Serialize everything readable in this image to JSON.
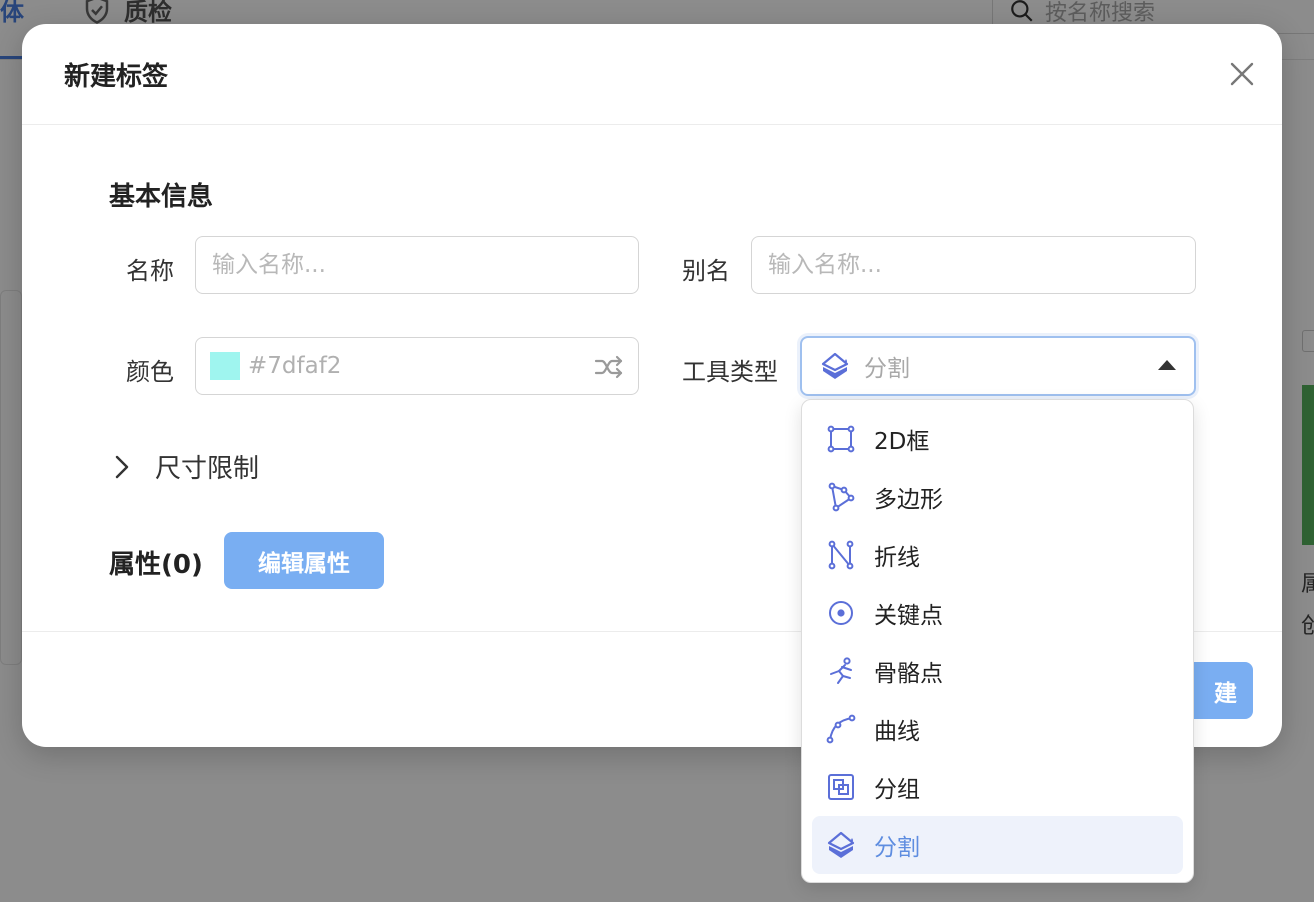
{
  "background": {
    "tab_active": "体",
    "tab_qc": "质检",
    "search_placeholder": "按名称搜索",
    "right_text_1": "属",
    "right_text_2": "创"
  },
  "modal": {
    "title": "新建标签",
    "section_basic": "基本信息",
    "name_label": "名称",
    "name_placeholder": "输入名称...",
    "alias_label": "别名",
    "alias_placeholder": "输入名称...",
    "color_label": "颜色",
    "color_value": "#7dfaf2",
    "swatch_color": "#9ff5ef",
    "tool_type_label": "工具类型",
    "tool_type_value": "分割",
    "size_limit_label": "尺寸限制",
    "attributes_label": "属性(0)",
    "edit_attributes_button": "编辑属性",
    "create_button": "建"
  },
  "dropdown": {
    "items": [
      {
        "label": "2D框",
        "icon": "box-2d-icon"
      },
      {
        "label": "多边形",
        "icon": "polygon-icon"
      },
      {
        "label": "折线",
        "icon": "polyline-icon"
      },
      {
        "label": "关键点",
        "icon": "keypoint-icon"
      },
      {
        "label": "骨骼点",
        "icon": "skeleton-icon"
      },
      {
        "label": "曲线",
        "icon": "curve-icon"
      },
      {
        "label": "分组",
        "icon": "group-icon"
      },
      {
        "label": "分割",
        "icon": "segmentation-icon",
        "selected": true
      }
    ]
  },
  "colors": {
    "icon_accent": "#5b6fd8",
    "primary_button": "#79aef2",
    "selected_text": "#5e8de0"
  }
}
